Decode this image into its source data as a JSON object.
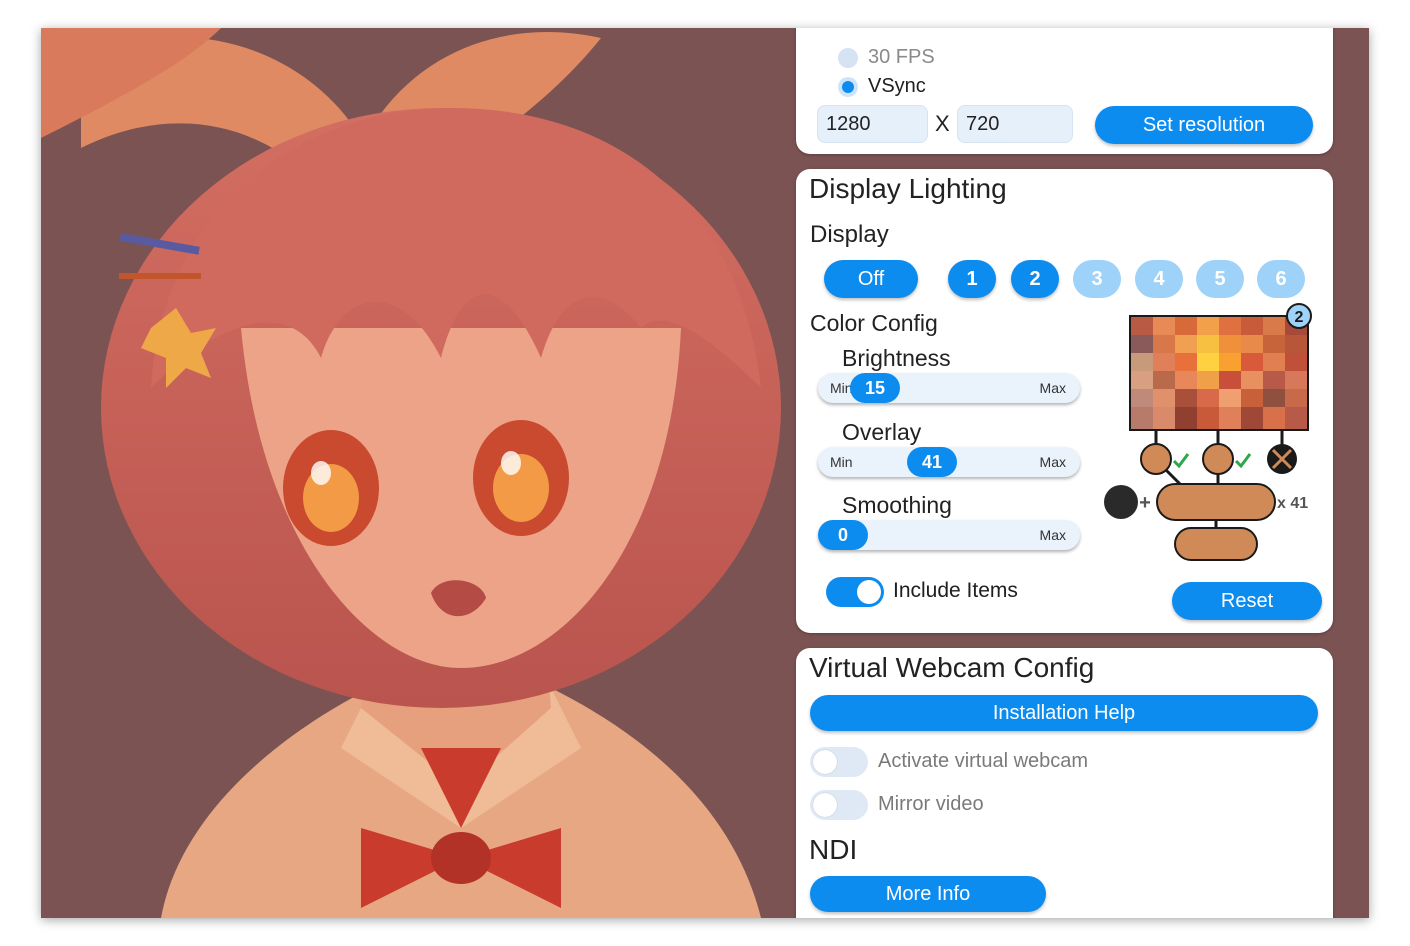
{
  "colors": {
    "accent": "#0d8cf0",
    "accent_light": "#9fd2f8",
    "background": "#7b5352",
    "card": "#ffffff"
  },
  "framerate": {
    "options": [
      {
        "label": "30 FPS",
        "selected": false
      },
      {
        "label": "VSync",
        "selected": true
      }
    ]
  },
  "resolution": {
    "width": "1280",
    "separator": "X",
    "height": "720",
    "set_label": "Set resolution"
  },
  "lighting": {
    "title": "Display Lighting",
    "display_label": "Display",
    "off_label": "Off",
    "displays": [
      {
        "label": "1",
        "state": "available"
      },
      {
        "label": "2",
        "state": "selected"
      },
      {
        "label": "3",
        "state": "disabled"
      },
      {
        "label": "4",
        "state": "disabled"
      },
      {
        "label": "5",
        "state": "disabled"
      },
      {
        "label": "6",
        "state": "disabled"
      }
    ],
    "color_config_label": "Color Config",
    "sliders": [
      {
        "label": "Brightness",
        "value": "15",
        "min_label": "Min",
        "max_label": "Max"
      },
      {
        "label": "Overlay",
        "value": "41",
        "min_label": "Min",
        "max_label": "Max"
      },
      {
        "label": "Smoothing",
        "value": "0",
        "min_label": "",
        "max_label": "Max"
      }
    ],
    "include_items_label": "Include Items",
    "include_items_on": true,
    "reset_label": "Reset",
    "preview": {
      "display_badge": "2",
      "multiplier": "x 41",
      "plus": "+"
    }
  },
  "webcam": {
    "title": "Virtual Webcam Config",
    "install_help_label": "Installation Help",
    "activate_label": "Activate virtual webcam",
    "activate_on": false,
    "mirror_label": "Mirror video",
    "mirror_on": false
  },
  "ndi": {
    "title": "NDI",
    "more_info_label": "More Info"
  }
}
